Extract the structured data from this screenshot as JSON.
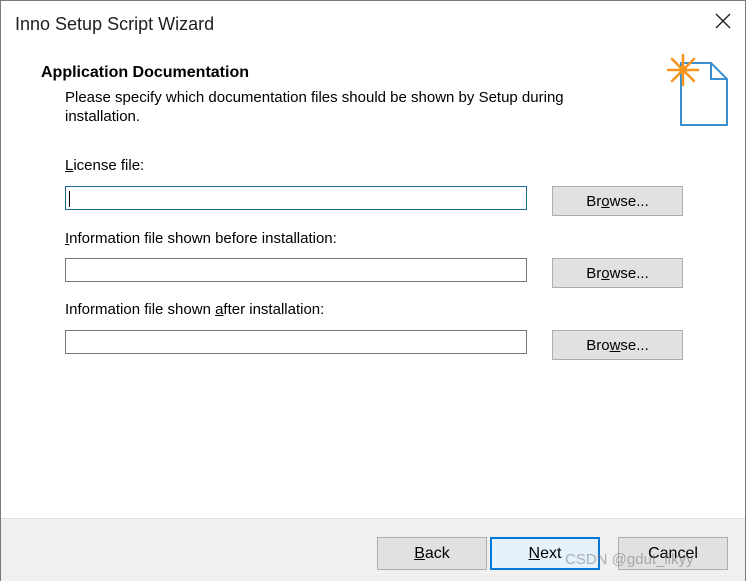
{
  "window": {
    "title": "Inno Setup Script Wizard",
    "close_glyph": "✕"
  },
  "header": {
    "title": "Application Documentation",
    "description": "Please specify which documentation files should be shown by Setup during installation.",
    "icon": "document-star-icon"
  },
  "fields": [
    {
      "label_pre": "",
      "label_accel": "L",
      "label_post": "icense file:",
      "value": "",
      "browse": {
        "pre": "Br",
        "accel": "o",
        "post": "wse..."
      }
    },
    {
      "label_pre": "",
      "label_accel": "I",
      "label_post": "nformation file shown before installation:",
      "value": "",
      "browse": {
        "pre": "Br",
        "accel": "o",
        "post": "wse..."
      }
    },
    {
      "label_pre": "Information file shown ",
      "label_accel": "a",
      "label_post": "fter installation:",
      "value": "",
      "browse": {
        "pre": "Bro",
        "accel": "w",
        "post": "se..."
      }
    }
  ],
  "footer": {
    "back": {
      "accel": "B",
      "post": "ack"
    },
    "next": {
      "accel": "N",
      "post": "ext"
    },
    "cancel": "Cancel"
  },
  "watermark": "CSDN @gdut_likyy",
  "colors": {
    "accent": "#0078d7",
    "icon_star": "#f7941d",
    "icon_doc": "#3a8fd1"
  }
}
